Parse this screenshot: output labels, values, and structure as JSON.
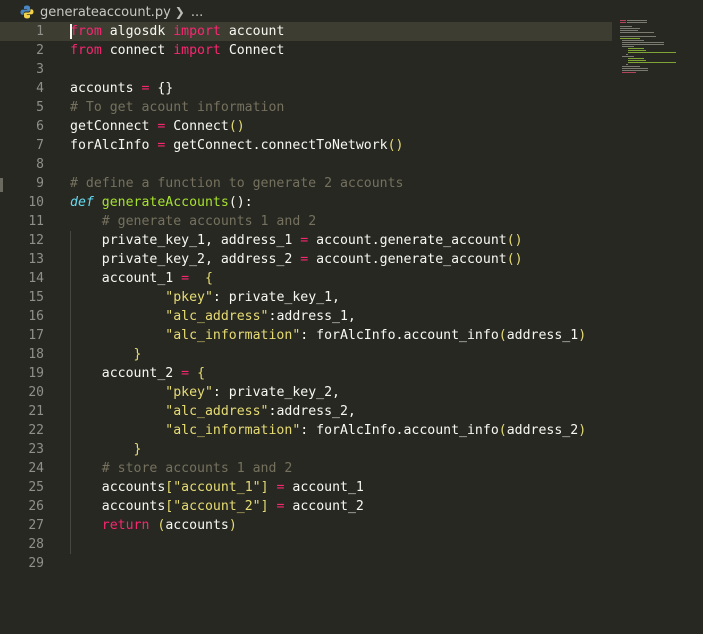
{
  "breadcrumb": {
    "file": "generateaccount.py",
    "more": "..."
  },
  "lines": [
    {
      "n": "1",
      "segs": [
        [
          "kw",
          "from"
        ],
        [
          "t",
          " algosdk "
        ],
        [
          "kw",
          "import"
        ],
        [
          "t",
          " account"
        ]
      ]
    },
    {
      "n": "2",
      "segs": [
        [
          "kw",
          "from"
        ],
        [
          "t",
          " connect "
        ],
        [
          "kw",
          "import"
        ],
        [
          "t",
          " Connect"
        ]
      ]
    },
    {
      "n": "3",
      "segs": []
    },
    {
      "n": "4",
      "segs": [
        [
          "t",
          "accounts "
        ],
        [
          "kw",
          "="
        ],
        [
          "t",
          " {}"
        ]
      ]
    },
    {
      "n": "5",
      "segs": [
        [
          "cmt",
          "# To get acount information"
        ]
      ]
    },
    {
      "n": "6",
      "segs": [
        [
          "t",
          "getConnect "
        ],
        [
          "kw",
          "="
        ],
        [
          "t",
          " Connect"
        ],
        [
          "br1",
          "()"
        ]
      ]
    },
    {
      "n": "7",
      "segs": [
        [
          "t",
          "forAlcInfo "
        ],
        [
          "kw",
          "="
        ],
        [
          "t",
          " getConnect.connectToNetwork"
        ],
        [
          "br1",
          "()"
        ]
      ]
    },
    {
      "n": "8",
      "segs": []
    },
    {
      "n": "9",
      "segs": [
        [
          "cmt",
          "# define a function to generate 2 accounts"
        ]
      ]
    },
    {
      "n": "10",
      "segs": [
        [
          "def",
          "def"
        ],
        [
          "t",
          " "
        ],
        [
          "fn",
          "generateAccounts"
        ],
        [
          "t",
          "():"
        ]
      ]
    },
    {
      "n": "11",
      "segs": [
        [
          "t",
          "    "
        ],
        [
          "cmt",
          "# generate accounts 1 and 2"
        ]
      ]
    },
    {
      "n": "12",
      "segs": [
        [
          "t",
          "    private_key_1, address_1 "
        ],
        [
          "kw",
          "="
        ],
        [
          "t",
          " account.generate_account"
        ],
        [
          "br1",
          "()"
        ]
      ]
    },
    {
      "n": "13",
      "segs": [
        [
          "t",
          "    private_key_2, address_2 "
        ],
        [
          "kw",
          "="
        ],
        [
          "t",
          " account.generate_account"
        ],
        [
          "br1",
          "()"
        ]
      ]
    },
    {
      "n": "14",
      "segs": [
        [
          "t",
          "    account_1 "
        ],
        [
          "kw",
          "="
        ],
        [
          "t",
          "  "
        ],
        [
          "br1",
          "{"
        ]
      ]
    },
    {
      "n": "15",
      "segs": [
        [
          "t",
          "            "
        ],
        [
          "str",
          "\"pkey\""
        ],
        [
          "t",
          ": private_key_1,"
        ]
      ]
    },
    {
      "n": "16",
      "segs": [
        [
          "t",
          "            "
        ],
        [
          "str",
          "\"alc_address\""
        ],
        [
          "t",
          ":address_1,"
        ]
      ]
    },
    {
      "n": "17",
      "segs": [
        [
          "t",
          "            "
        ],
        [
          "str",
          "\"alc_information\""
        ],
        [
          "t",
          ": forAlcInfo.account_info"
        ],
        [
          "br1",
          "("
        ],
        [
          "t",
          "address_1"
        ],
        [
          "br1",
          ")"
        ]
      ]
    },
    {
      "n": "18",
      "segs": [
        [
          "t",
          "        "
        ],
        [
          "br1",
          "}"
        ]
      ]
    },
    {
      "n": "19",
      "segs": [
        [
          "t",
          "    account_2 "
        ],
        [
          "kw",
          "="
        ],
        [
          "t",
          " "
        ],
        [
          "br1",
          "{"
        ]
      ]
    },
    {
      "n": "20",
      "segs": [
        [
          "t",
          "            "
        ],
        [
          "str",
          "\"pkey\""
        ],
        [
          "t",
          ": private_key_2,"
        ]
      ]
    },
    {
      "n": "21",
      "segs": [
        [
          "t",
          "            "
        ],
        [
          "str",
          "\"alc_address\""
        ],
        [
          "t",
          ":address_2,"
        ]
      ]
    },
    {
      "n": "22",
      "segs": [
        [
          "t",
          "            "
        ],
        [
          "str",
          "\"alc_information\""
        ],
        [
          "t",
          ": forAlcInfo.account_info"
        ],
        [
          "br1",
          "("
        ],
        [
          "t",
          "address_2"
        ],
        [
          "br1",
          ")"
        ]
      ]
    },
    {
      "n": "23",
      "segs": [
        [
          "t",
          "        "
        ],
        [
          "br1",
          "}"
        ]
      ]
    },
    {
      "n": "24",
      "segs": [
        [
          "t",
          "    "
        ],
        [
          "cmt",
          "# store accounts 1 and 2"
        ]
      ]
    },
    {
      "n": "25",
      "segs": [
        [
          "t",
          "    accounts"
        ],
        [
          "br1",
          "["
        ],
        [
          "str",
          "\"account_1\""
        ],
        [
          "br1",
          "]"
        ],
        [
          "t",
          " "
        ],
        [
          "kw",
          "="
        ],
        [
          "t",
          " account_1"
        ]
      ]
    },
    {
      "n": "26",
      "segs": [
        [
          "t",
          "    accounts"
        ],
        [
          "br1",
          "["
        ],
        [
          "str",
          "\"account_2\""
        ],
        [
          "br1",
          "]"
        ],
        [
          "t",
          " "
        ],
        [
          "kw",
          "="
        ],
        [
          "t",
          " account_2"
        ]
      ]
    },
    {
      "n": "27",
      "segs": [
        [
          "t",
          "    "
        ],
        [
          "kw",
          "return"
        ],
        [
          "t",
          " "
        ],
        [
          "br1",
          "("
        ],
        [
          "t",
          "accounts"
        ],
        [
          "br1",
          ")"
        ]
      ]
    },
    {
      "n": "28",
      "segs": []
    },
    {
      "n": "29",
      "segs": []
    }
  ],
  "icons": {
    "file_icon": "python-icon",
    "separator": "chevron-right-icon"
  }
}
